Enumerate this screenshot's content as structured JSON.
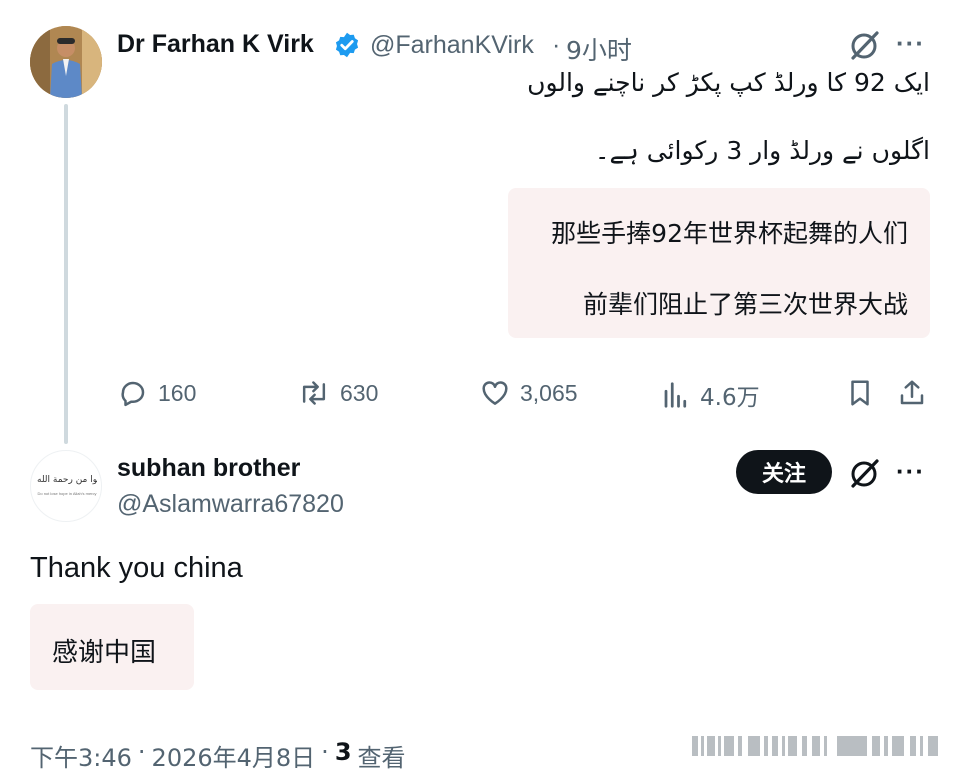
{
  "post": {
    "author_name": "Dr Farhan K Virk",
    "author_handle": "@FarhanKVirk",
    "separator": "·",
    "time_ago": "9小时",
    "text_line1": "ایک 92 کا ورلڈ کپ پکڑ کر ناچنے والوں",
    "text_line2": "اگلوں نے ورلڈ وار 3 رکوائی ہے۔",
    "translation_line1": "那些手捧92年世界杯起舞的人们",
    "translation_line2": "前辈们阻止了第三次世界大战",
    "replies": "160",
    "reposts": "630",
    "likes": "3,065",
    "views": "4.6万"
  },
  "reply": {
    "author_name": "subhan brother",
    "author_handle": "@Aslamwarra67820",
    "follow_label": "关注",
    "text": "Thank you china",
    "translation": "感谢中国",
    "avatar_text": "لا تقنطوا من رحمة الله",
    "avatar_subtext": "Do not lose hope in Allah's mercy"
  },
  "footer": {
    "time": "下午3:46",
    "sep1": "·",
    "date": "2026年4月8日",
    "sep2": "·",
    "views_count": "3",
    "views_label": "查看"
  },
  "colors": {
    "verified": "#1d9bf0",
    "muted": "#536471",
    "translation_bg": "#faf1f1"
  },
  "icons": {
    "verified": "verified-badge-icon",
    "grok": "grok-icon",
    "more": "more-dots-icon",
    "reply": "reply-icon",
    "repost": "repost-icon",
    "like": "heart-icon",
    "views": "views-chart-icon",
    "bookmark": "bookmark-icon",
    "share": "share-icon"
  }
}
